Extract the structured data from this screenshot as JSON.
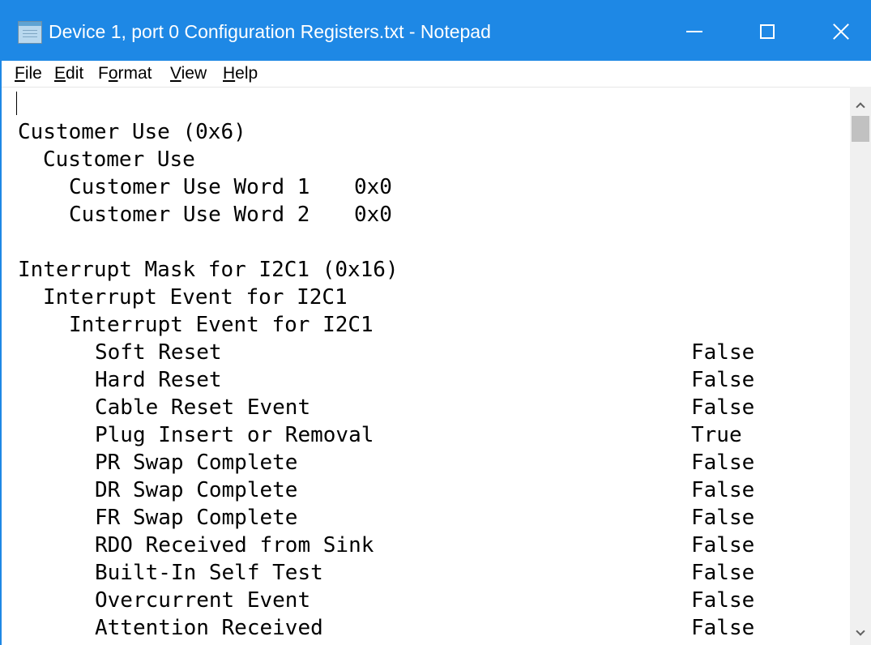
{
  "window": {
    "title": "Device 1, port 0 Configuration Registers.txt - Notepad",
    "app_icon": "notepad-icon",
    "accent_color": "#1e88e5"
  },
  "menu": {
    "file": {
      "mnemonic": "F",
      "rest": "ile"
    },
    "edit": {
      "mnemonic": "E",
      "rest": "dit"
    },
    "format": {
      "pre": "F",
      "mnemonic": "o",
      "rest": "rmat"
    },
    "view": {
      "mnemonic": "V",
      "rest": "iew"
    },
    "help": {
      "mnemonic": "H",
      "rest": "elp"
    }
  },
  "document": {
    "customer_section": {
      "heading": "Customer Use (0x6)",
      "subheading": "Customer Use",
      "fields": [
        {
          "label": "Customer Use Word 1",
          "value": "0x0"
        },
        {
          "label": "Customer Use Word 2",
          "value": "0x0"
        }
      ]
    },
    "interrupt_section": {
      "heading": "Interrupt Mask for I2C1 (0x16)",
      "subheading": "Interrupt Event for I2C1",
      "group": "Interrupt Event for I2C1",
      "fields": [
        {
          "label": "Soft Reset",
          "value": "False"
        },
        {
          "label": "Hard Reset",
          "value": "False"
        },
        {
          "label": "Cable Reset Event",
          "value": "False"
        },
        {
          "label": "Plug Insert or Removal",
          "value": "True"
        },
        {
          "label": "PR Swap Complete",
          "value": "False"
        },
        {
          "label": "DR Swap Complete",
          "value": "False"
        },
        {
          "label": "FR Swap Complete",
          "value": "False"
        },
        {
          "label": "RDO Received from Sink",
          "value": "False"
        },
        {
          "label": "Built-In Self Test",
          "value": "False"
        },
        {
          "label": "Overcurrent Event",
          "value": "False"
        },
        {
          "label": "Attention Received",
          "value": "False"
        }
      ]
    }
  }
}
